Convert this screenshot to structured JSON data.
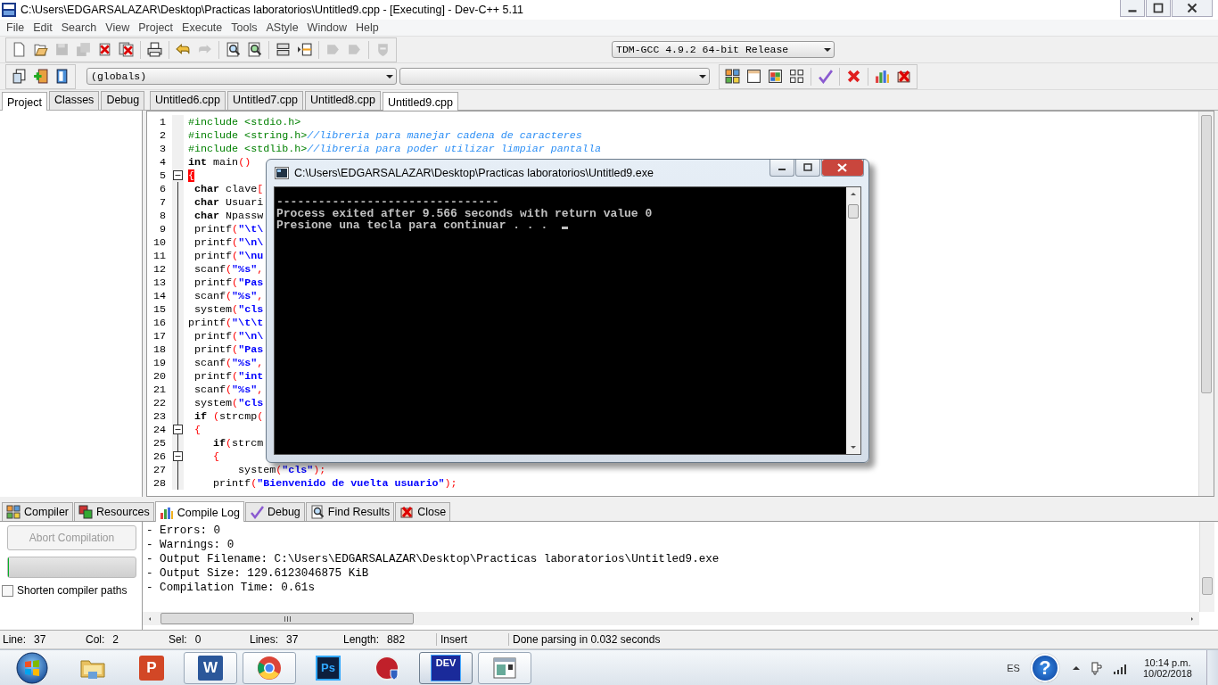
{
  "window": {
    "title": "C:\\Users\\EDGARSALAZAR\\Desktop\\Practicas laboratorios\\Untitled9.cpp - [Executing] - Dev-C++ 5.11"
  },
  "menu": [
    "File",
    "Edit",
    "Search",
    "View",
    "Project",
    "Execute",
    "Tools",
    "AStyle",
    "Window",
    "Help"
  ],
  "toolbar_1": [
    {
      "kind": "new",
      "disabled": false
    },
    {
      "kind": "open",
      "disabled": false
    },
    {
      "kind": "save",
      "disabled": true
    },
    {
      "kind": "saveall",
      "disabled": true
    },
    {
      "kind": "close",
      "disabled": false
    },
    {
      "kind": "closeall",
      "disabled": false
    },
    {
      "kind": "sep"
    },
    {
      "kind": "print",
      "disabled": false
    },
    {
      "kind": "sep"
    },
    {
      "kind": "undo",
      "disabled": false
    },
    {
      "kind": "redo",
      "disabled": true
    },
    {
      "kind": "sep"
    },
    {
      "kind": "find",
      "disabled": false
    },
    {
      "kind": "replace",
      "disabled": false
    },
    {
      "kind": "sep"
    },
    {
      "kind": "indent",
      "disabled": false
    },
    {
      "kind": "unindent",
      "disabled": false
    },
    {
      "kind": "sep"
    },
    {
      "kind": "goto",
      "disabled": true
    },
    {
      "kind": "goto",
      "disabled": true
    },
    {
      "kind": "sep"
    },
    {
      "kind": "shield",
      "disabled": true
    }
  ],
  "compiler_select": {
    "value": "TDM-GCC 4.9.2 64-bit Release"
  },
  "toolbar_2_left": [
    {
      "kind": "newproj"
    },
    {
      "kind": "addproj"
    },
    {
      "kind": "classbrowser"
    }
  ],
  "scope_select": {
    "value": "(globals)"
  },
  "toolbar_2_right": [
    {
      "kind": "compile"
    },
    {
      "kind": "run"
    },
    {
      "kind": "compilerun"
    },
    {
      "kind": "rebuild"
    },
    {
      "kind": "sep"
    },
    {
      "kind": "check"
    },
    {
      "kind": "sep"
    },
    {
      "kind": "stop"
    },
    {
      "kind": "sep"
    },
    {
      "kind": "chart"
    },
    {
      "kind": "debugx"
    }
  ],
  "left_tabs": [
    {
      "label": "Project",
      "selected": true
    },
    {
      "label": "Classes",
      "selected": false
    },
    {
      "label": "Debug",
      "selected": false
    }
  ],
  "editor_tabs": [
    {
      "label": "Untitled6.cpp",
      "selected": false
    },
    {
      "label": "Untitled7.cpp",
      "selected": false
    },
    {
      "label": "Untitled8.cpp",
      "selected": false
    },
    {
      "label": "Untitled9.cpp",
      "selected": true
    }
  ],
  "code_lines": [
    {
      "n": "1",
      "fold": false,
      "parts": [
        {
          "kind": "pre",
          "text": "#include <stdio.h>"
        }
      ]
    },
    {
      "n": "2",
      "fold": false,
      "parts": [
        {
          "kind": "pre",
          "text": "#include <string.h>"
        },
        {
          "kind": "com",
          "text": "//libreria para manejar cadena de caracteres"
        }
      ]
    },
    {
      "n": "3",
      "fold": false,
      "parts": [
        {
          "kind": "pre",
          "text": "#include <stdlib.h>"
        },
        {
          "kind": "com",
          "text": "//libreria para poder utilizar limpiar pantalla"
        }
      ]
    },
    {
      "n": "4",
      "fold": false,
      "parts": [
        {
          "kind": "kw",
          "text": "int"
        },
        {
          "kind": "txt",
          "text": " main"
        },
        {
          "kind": "sym",
          "text": "()"
        }
      ]
    },
    {
      "n": "5",
      "fold": true,
      "parts": [
        {
          "kind": "match",
          "text": "{"
        }
      ]
    },
    {
      "n": "6",
      "fold": false,
      "parts": [
        {
          "kind": "kw",
          "text": " char"
        },
        {
          "kind": "txt",
          "text": " clave"
        },
        {
          "kind": "sym",
          "text": "["
        }
      ]
    },
    {
      "n": "7",
      "fold": false,
      "parts": [
        {
          "kind": "kw",
          "text": " char"
        },
        {
          "kind": "txt",
          "text": " Usuari"
        }
      ]
    },
    {
      "n": "8",
      "fold": false,
      "parts": [
        {
          "kind": "kw",
          "text": " char"
        },
        {
          "kind": "txt",
          "text": " Npassw"
        }
      ]
    },
    {
      "n": "9",
      "fold": false,
      "parts": [
        {
          "kind": "txt",
          "text": " printf"
        },
        {
          "kind": "sym",
          "text": "("
        },
        {
          "kind": "str",
          "text": "\"\\t\\"
        }
      ]
    },
    {
      "n": "10",
      "fold": false,
      "parts": [
        {
          "kind": "txt",
          "text": " printf"
        },
        {
          "kind": "sym",
          "text": "("
        },
        {
          "kind": "str",
          "text": "\"\\n\\"
        }
      ]
    },
    {
      "n": "11",
      "fold": false,
      "parts": [
        {
          "kind": "txt",
          "text": " printf"
        },
        {
          "kind": "sym",
          "text": "("
        },
        {
          "kind": "str",
          "text": "\"\\nu"
        }
      ]
    },
    {
      "n": "12",
      "fold": false,
      "parts": [
        {
          "kind": "txt",
          "text": " scanf"
        },
        {
          "kind": "sym",
          "text": "("
        },
        {
          "kind": "str",
          "text": "\"%s\""
        },
        {
          "kind": "sym",
          "text": ","
        }
      ]
    },
    {
      "n": "13",
      "fold": false,
      "parts": [
        {
          "kind": "txt",
          "text": " printf"
        },
        {
          "kind": "sym",
          "text": "("
        },
        {
          "kind": "str",
          "text": "\"Pas"
        }
      ]
    },
    {
      "n": "14",
      "fold": false,
      "parts": [
        {
          "kind": "txt",
          "text": " scanf"
        },
        {
          "kind": "sym",
          "text": "("
        },
        {
          "kind": "str",
          "text": "\"%s\""
        },
        {
          "kind": "sym",
          "text": ","
        }
      ]
    },
    {
      "n": "15",
      "fold": false,
      "parts": [
        {
          "kind": "txt",
          "text": " system"
        },
        {
          "kind": "sym",
          "text": "("
        },
        {
          "kind": "str",
          "text": "\"cls"
        }
      ]
    },
    {
      "n": "16",
      "fold": false,
      "parts": [
        {
          "kind": "txt",
          "text": "printf"
        },
        {
          "kind": "sym",
          "text": "("
        },
        {
          "kind": "str",
          "text": "\"\\t\\t"
        }
      ]
    },
    {
      "n": "17",
      "fold": false,
      "parts": [
        {
          "kind": "txt",
          "text": " printf"
        },
        {
          "kind": "sym",
          "text": "("
        },
        {
          "kind": "str",
          "text": "\"\\n\\"
        }
      ]
    },
    {
      "n": "18",
      "fold": false,
      "parts": [
        {
          "kind": "txt",
          "text": " printf"
        },
        {
          "kind": "sym",
          "text": "("
        },
        {
          "kind": "str",
          "text": "\"Pas"
        }
      ]
    },
    {
      "n": "19",
      "fold": false,
      "parts": [
        {
          "kind": "txt",
          "text": " scanf"
        },
        {
          "kind": "sym",
          "text": "("
        },
        {
          "kind": "str",
          "text": "\"%s\""
        },
        {
          "kind": "sym",
          "text": ","
        }
      ]
    },
    {
      "n": "20",
      "fold": false,
      "parts": [
        {
          "kind": "txt",
          "text": " printf"
        },
        {
          "kind": "sym",
          "text": "("
        },
        {
          "kind": "str",
          "text": "\"int"
        }
      ]
    },
    {
      "n": "21",
      "fold": false,
      "parts": [
        {
          "kind": "txt",
          "text": " scanf"
        },
        {
          "kind": "sym",
          "text": "("
        },
        {
          "kind": "str",
          "text": "\"%s\""
        },
        {
          "kind": "sym",
          "text": ","
        }
      ]
    },
    {
      "n": "22",
      "fold": false,
      "parts": [
        {
          "kind": "txt",
          "text": " system"
        },
        {
          "kind": "sym",
          "text": "("
        },
        {
          "kind": "str",
          "text": "\"cls"
        }
      ]
    },
    {
      "n": "23",
      "fold": false,
      "parts": [
        {
          "kind": "kw",
          "text": " if"
        },
        {
          "kind": "sym",
          "text": " ("
        },
        {
          "kind": "txt",
          "text": "strcmp"
        },
        {
          "kind": "sym",
          "text": "("
        }
      ]
    },
    {
      "n": "24",
      "fold": true,
      "parts": [
        {
          "kind": "sym",
          "text": " {"
        }
      ]
    },
    {
      "n": "25",
      "fold": false,
      "parts": [
        {
          "kind": "kw",
          "text": "    if"
        },
        {
          "kind": "sym",
          "text": "("
        },
        {
          "kind": "txt",
          "text": "strcm"
        }
      ]
    },
    {
      "n": "26",
      "fold": true,
      "parts": [
        {
          "kind": "sym",
          "text": "    {"
        }
      ]
    },
    {
      "n": "27",
      "fold": false,
      "parts": [
        {
          "kind": "txt",
          "text": "        system"
        },
        {
          "kind": "sym",
          "text": "("
        },
        {
          "kind": "str",
          "text": "\"cls\""
        },
        {
          "kind": "sym",
          "text": ");"
        }
      ]
    },
    {
      "n": "28",
      "fold": false,
      "parts": [
        {
          "kind": "txt",
          "text": "    printf"
        },
        {
          "kind": "sym",
          "text": "("
        },
        {
          "kind": "str",
          "text": "\"Bienvenido de vuelta usuario\""
        },
        {
          "kind": "sym",
          "text": ");"
        }
      ]
    }
  ],
  "console": {
    "title": "C:\\Users\\EDGARSALAZAR\\Desktop\\Practicas laboratorios\\Untitled9.exe",
    "lines": [
      "--------------------------------",
      "Process exited after 9.566 seconds with return value 0",
      "Presione una tecla para continuar . . . "
    ]
  },
  "bottom_tabs": [
    {
      "kind": "compiler",
      "label": "Compiler",
      "selected": false
    },
    {
      "kind": "resources",
      "label": "Resources",
      "selected": false
    },
    {
      "kind": "log",
      "label": "Compile Log",
      "selected": true
    },
    {
      "kind": "debug",
      "label": "Debug",
      "selected": false
    },
    {
      "kind": "find",
      "label": "Find Results",
      "selected": false
    },
    {
      "kind": "close",
      "label": "Close",
      "selected": false
    }
  ],
  "abort_button": {
    "label": "Abort Compilation",
    "disabled": true
  },
  "progress": {
    "level": 0
  },
  "shorten_paths": {
    "label": "Shorten compiler paths",
    "checked": false
  },
  "compile_log": [
    "- Errors: 0",
    "- Warnings: 0",
    "- Output Filename: C:\\Users\\EDGARSALAZAR\\Desktop\\Practicas laboratorios\\Untitled9.exe",
    "- Output Size: 129.6123046875 KiB",
    "- Compilation Time: 0.61s"
  ],
  "status_bar": {
    "fields": [
      {
        "label": "Line:",
        "value": "37"
      },
      {
        "label": "Col:",
        "value": "2"
      },
      {
        "label": "Sel:",
        "value": "0"
      },
      {
        "label": "Lines:",
        "value": "37"
      },
      {
        "label": "Length:",
        "value": "882"
      }
    ],
    "mode": "Insert",
    "message": "Done parsing in 0.032 seconds"
  },
  "taskbar": [
    {
      "kind": "folder",
      "open": false,
      "active": false
    },
    {
      "kind": "slides",
      "label": "P",
      "open": false,
      "active": false
    },
    {
      "kind": "doc",
      "label": "W",
      "open": true,
      "active": false
    },
    {
      "kind": "browser",
      "open": true,
      "active": false
    },
    {
      "kind": "imgedit",
      "label": "Ps",
      "open": false,
      "active": false
    },
    {
      "kind": "record",
      "open": false,
      "active": false
    },
    {
      "kind": "ide",
      "label": "DEV",
      "open": true,
      "active": true
    },
    {
      "kind": "window",
      "open": true,
      "active": false
    }
  ],
  "tray": {
    "language": "ES",
    "help": "?",
    "time": "10:14 p.m.",
    "date": "10/02/2018"
  }
}
